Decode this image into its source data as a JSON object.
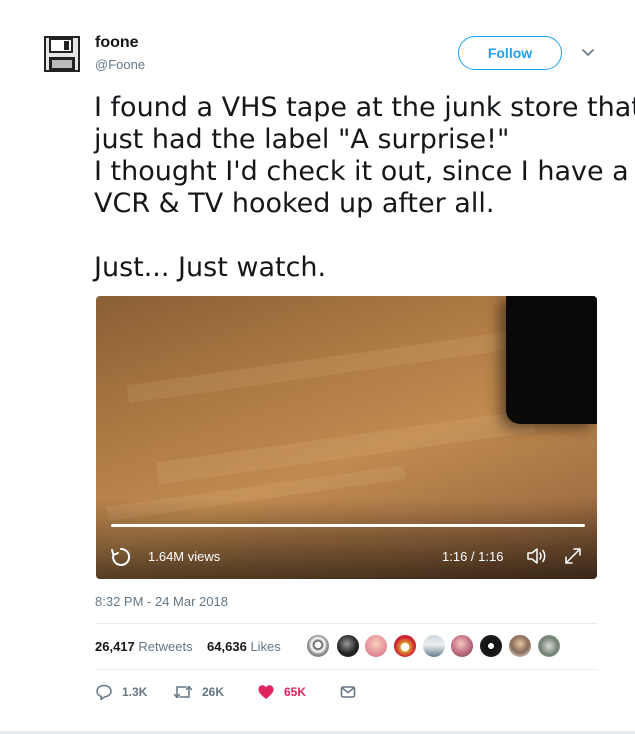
{
  "author": {
    "name": "foone",
    "handle": "@Foone",
    "avatar_icon": "floppy-disk-icon"
  },
  "follow_label": "Follow",
  "tweet": {
    "lines": [
      "I found a VHS tape at the junk store that",
      "just had the label \"A surprise!\"",
      "I thought I'd check it out, since I have a",
      "VCR & TV hooked up after all.",
      "",
      "Just... Just watch."
    ]
  },
  "video": {
    "views": "1.64M views",
    "time": "1:16 / 1:16",
    "progress": 1.0,
    "controls": [
      "replay-icon",
      "volume-icon",
      "expand-icon"
    ]
  },
  "timestamp": "8:32 PM - 24 Mar 2018",
  "stats": {
    "retweets_count": "26,417",
    "retweets_label": "Retweets",
    "likes_count": "64,636",
    "likes_label": "Likes"
  },
  "actions": {
    "reply_count": "1.3K",
    "retweet_count": "26K",
    "like_count": "65K"
  },
  "colors": {
    "accent": "#1da1f2",
    "like": "#e0245e",
    "secondary_text": "#657786"
  }
}
